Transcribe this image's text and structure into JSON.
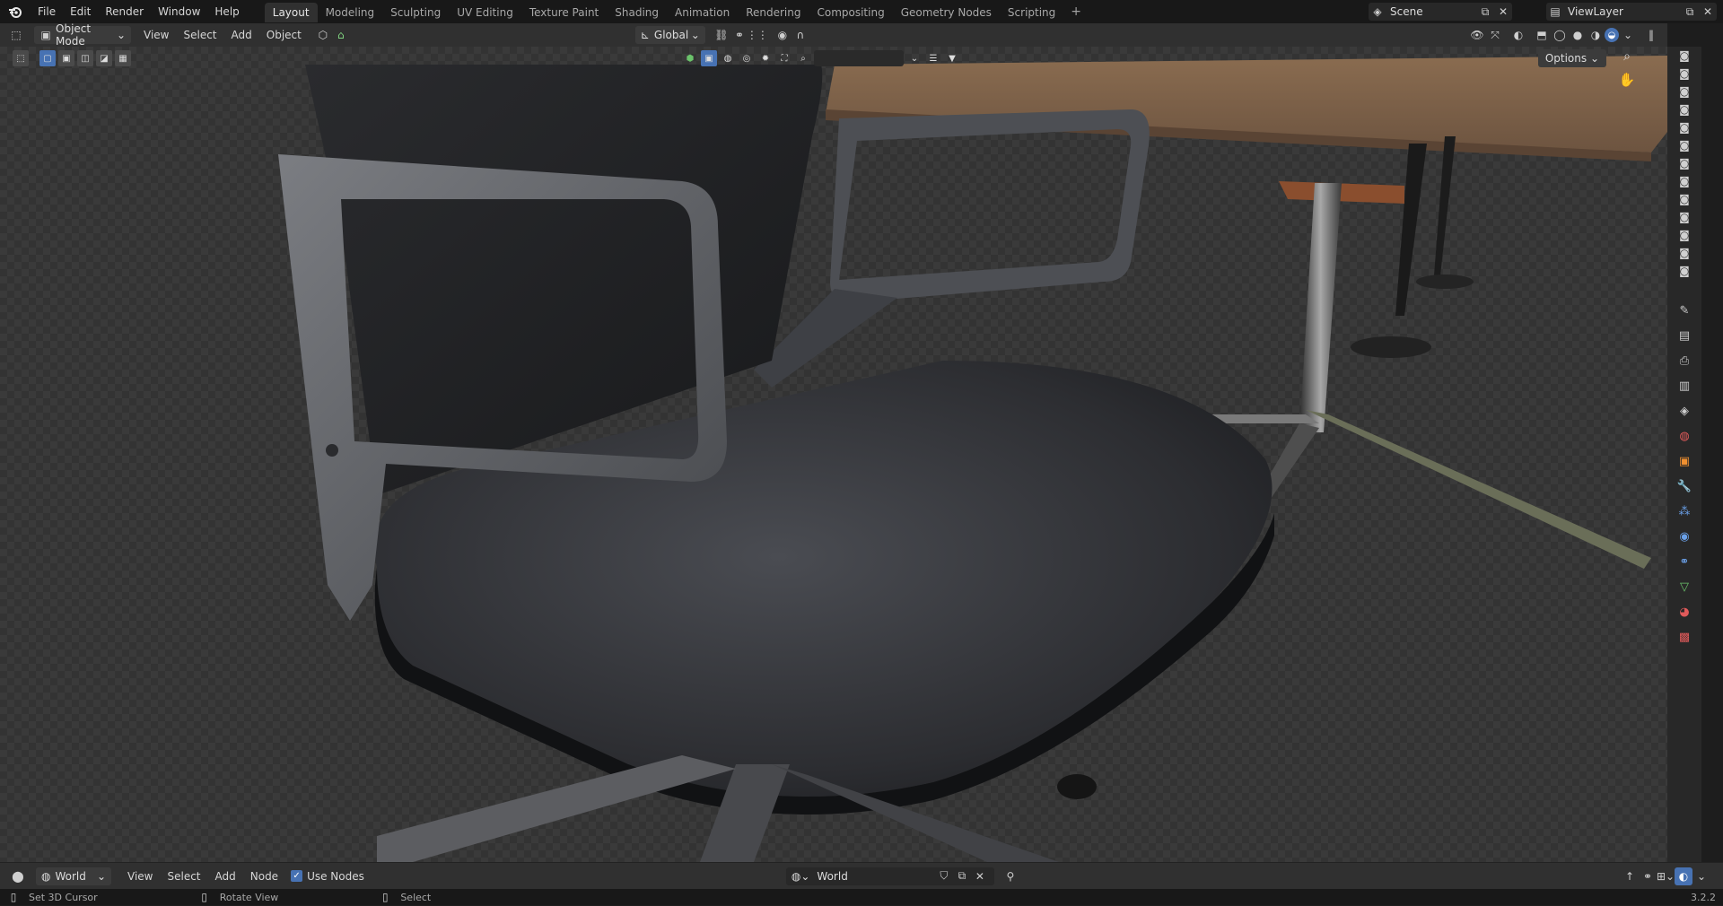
{
  "topbar": {
    "menus": [
      "File",
      "Edit",
      "Render",
      "Window",
      "Help"
    ],
    "workspaces": [
      "Layout",
      "Modeling",
      "Sculpting",
      "UV Editing",
      "Texture Paint",
      "Shading",
      "Animation",
      "Rendering",
      "Compositing",
      "Geometry Nodes",
      "Scripting"
    ],
    "active_workspace": "Layout",
    "add_tab": "+",
    "scene": "Scene",
    "view_layer": "ViewLayer"
  },
  "header": {
    "mode": "Object Mode",
    "menus": [
      "View",
      "Select",
      "Add",
      "Object"
    ],
    "orientation": "Global",
    "options": "Options"
  },
  "node_header": {
    "type": "World",
    "menus": [
      "View",
      "Select",
      "Add",
      "Node"
    ],
    "use_nodes": "Use Nodes",
    "world_name": "World"
  },
  "status": {
    "left": "Set 3D Cursor",
    "middle": "Rotate View",
    "right": "Select",
    "version": "3.2.2"
  },
  "colors": {
    "accent": "#4772b3",
    "background": "#1d1d1d",
    "header": "#303030"
  },
  "icons": {
    "logo": "blender-logo-icon",
    "camera": "camera-icon",
    "hand": "hand-pan-icon",
    "zoom": "zoom-icon"
  }
}
